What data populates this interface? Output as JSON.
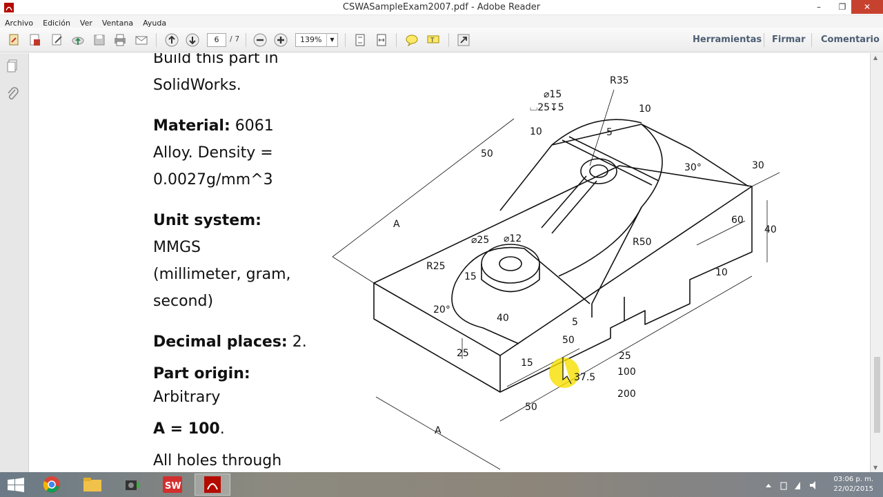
{
  "window": {
    "title": "CSWASampleExam2007.pdf - Adobe Reader"
  },
  "menu": [
    "Archivo",
    "Edición",
    "Ver",
    "Ventana",
    "Ayuda"
  ],
  "toolbar": {
    "page_current": "6",
    "page_total": "/ 7",
    "zoom": "139%",
    "tools_label": "Herramientas",
    "sign_label": "Firmar",
    "comment_label": "Comentario"
  },
  "document": {
    "line1": "Build this part in",
    "line2": "SolidWorks.",
    "material_label": "Material:",
    "material_value": " 6061",
    "material_line2": "Alloy.  Density =",
    "material_line3": "0.0027g/mm^3",
    "unit_label": "Unit system:",
    "unit_line1": "MMGS",
    "unit_line2": "(millimeter, gram,",
    "unit_line3": "second)",
    "decimal_label": "Decimal places:",
    "decimal_value": " 2.",
    "origin_label": "Part origin:",
    "origin_value": "Arbitrary",
    "a_label": "A = 100",
    "a_tail": ".",
    "holes_line": "All holes through"
  },
  "drawing_dims": {
    "r35": "R35",
    "d15": "⌀15",
    "cbore": "⌴25↧5",
    "d10a": "10",
    "d10b": "10",
    "d5a": "5",
    "d50a": "50",
    "d30deg": "30°",
    "d30": "30",
    "d60": "60",
    "d40a": "40",
    "A1": "A",
    "d25": "⌀25",
    "d12": "⌀12",
    "r25": "R25",
    "r50": "R50",
    "d15b": "15",
    "d20deg": "20°",
    "d40b": "40",
    "d5b": "5",
    "d10c": "10",
    "d25b": "25",
    "d50b": "50",
    "d15c": "15",
    "d375": "37.5",
    "d25c": "25",
    "d100": "100",
    "d200": "200",
    "d50c": "50",
    "A2": "A"
  },
  "taskbar": {
    "time": "03:06 p. m.",
    "date": "22/02/2015"
  }
}
